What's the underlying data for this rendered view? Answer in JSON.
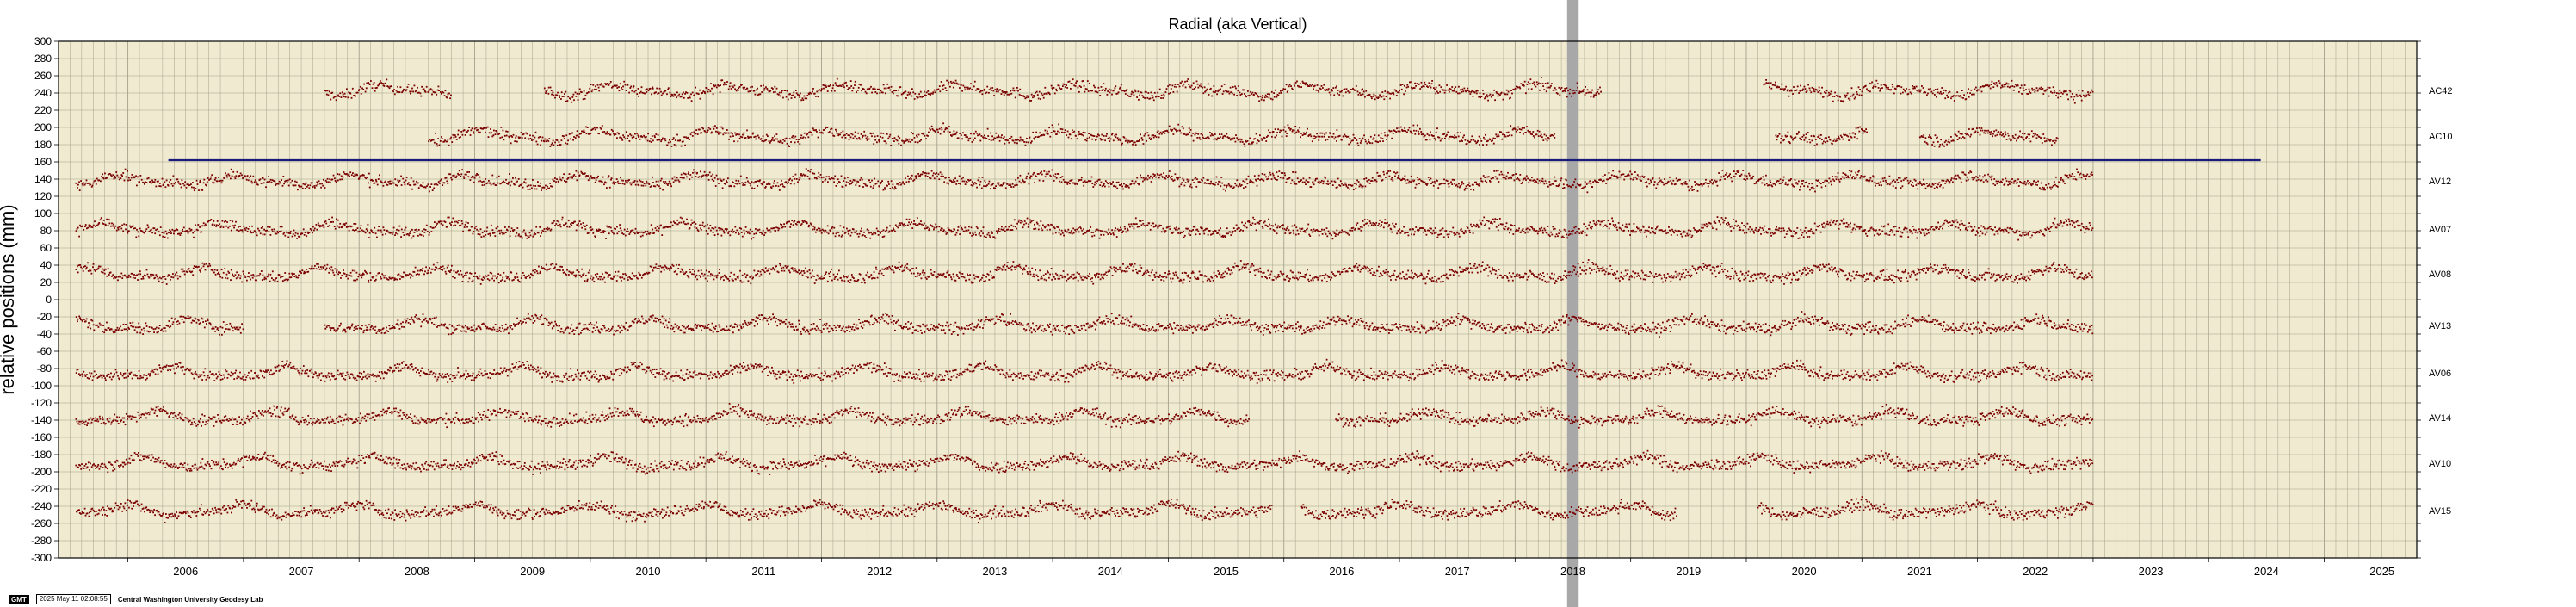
{
  "chart_data": {
    "type": "scatter",
    "title": "Radial (aka Vertical)",
    "xlabel": "",
    "ylabel": "relative positions (mm)",
    "xlim": [
      2005.4,
      2025.8
    ],
    "ylim": [
      -300,
      300
    ],
    "x_ticks": [
      "2006",
      "2007",
      "2008",
      "2009",
      "2010",
      "2011",
      "2012",
      "2013",
      "2014",
      "2015",
      "2016",
      "2017",
      "2018",
      "2019",
      "2020",
      "2021",
      "2022",
      "2023",
      "2024",
      "2025"
    ],
    "y_ticks": [
      "300",
      "280",
      "260",
      "240",
      "220",
      "200",
      "180",
      "160",
      "140",
      "120",
      "100",
      "80",
      "60",
      "40",
      "20",
      "0",
      "-20",
      "-40",
      "-60",
      "-80",
      "-100",
      "-120",
      "-140",
      "-160",
      "-180",
      "-200",
      "-220",
      "-240",
      "-260",
      "-280",
      "-300"
    ],
    "grid": true,
    "colors": {
      "plot_background": "#f0ead0",
      "grid": "#8a8a74",
      "points": "#7a0000",
      "reference_line": "#1a1a7a",
      "gap_band": "#a8a8a8"
    },
    "series": [
      {
        "name": "AC42",
        "offset": 243,
        "segments": [
          [
            2007.7,
            2008.8
          ],
          [
            2009.6,
            2018.75
          ],
          [
            2020.15,
            2023.0
          ]
        ]
      },
      {
        "name": "AC10",
        "offset": 190,
        "segments": [
          [
            2008.6,
            2018.35
          ],
          [
            2020.25,
            2021.05
          ],
          [
            2021.5,
            2022.7
          ]
        ]
      },
      {
        "name": "AV12",
        "offset": 138,
        "segments": [
          [
            2005.55,
            2023.0
          ]
        ]
      },
      {
        "name": "AV07",
        "offset": 82,
        "segments": [
          [
            2005.55,
            2023.0
          ]
        ]
      },
      {
        "name": "AV08",
        "offset": 30,
        "segments": [
          [
            2005.55,
            2023.0
          ]
        ]
      },
      {
        "name": "AV13",
        "offset": -30,
        "segments": [
          [
            2005.55,
            2007.0
          ],
          [
            2007.7,
            2023.0
          ]
        ]
      },
      {
        "name": "AV06",
        "offset": -85,
        "segments": [
          [
            2005.55,
            2023.0
          ]
        ]
      },
      {
        "name": "AV14",
        "offset": -137,
        "segments": [
          [
            2005.55,
            2015.7
          ],
          [
            2016.45,
            2023.0
          ]
        ]
      },
      {
        "name": "AV10",
        "offset": -190,
        "segments": [
          [
            2005.55,
            2023.0
          ]
        ]
      },
      {
        "name": "AV15",
        "offset": -245,
        "segments": [
          [
            2005.55,
            2015.9
          ],
          [
            2016.15,
            2019.4
          ],
          [
            2020.1,
            2023.0
          ]
        ]
      }
    ],
    "reference_line": {
      "y": 162,
      "x_start": 2006.35,
      "x_end": 2024.45
    },
    "gap_band": {
      "x_start": 2018.45,
      "x_end": 2018.55
    }
  },
  "footer": {
    "badge": "GMT",
    "timestamp": "2025 May 11 02:08:55",
    "credit": "Central Washington University Geodesy Lab"
  }
}
